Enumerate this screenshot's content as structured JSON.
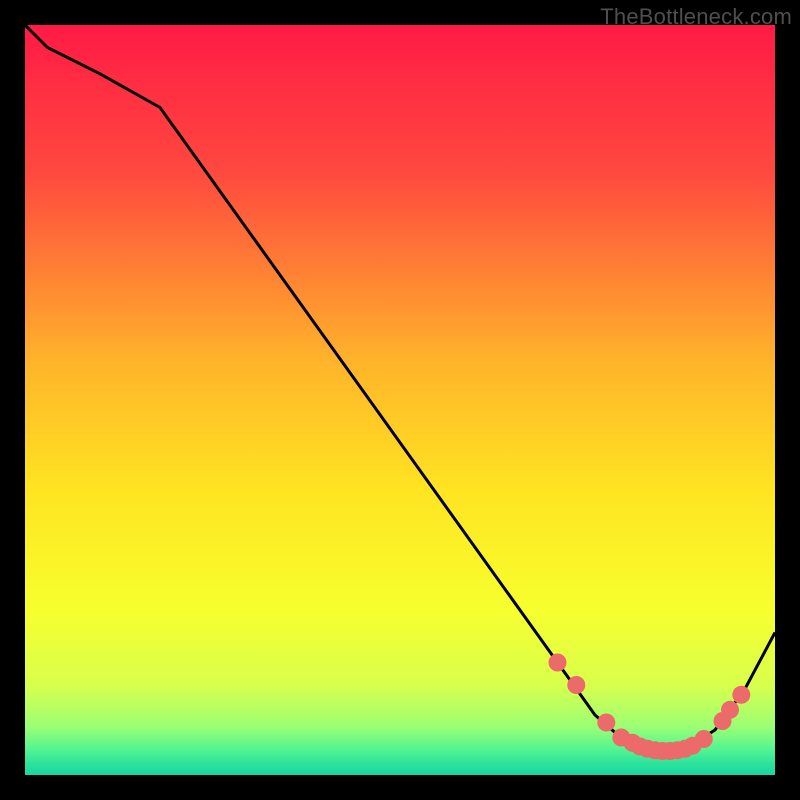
{
  "watermark": "TheBottleneck.com",
  "chart_data": {
    "type": "line",
    "title": "",
    "xlabel": "",
    "ylabel": "",
    "xlim": [
      0,
      100
    ],
    "ylim": [
      0,
      100
    ],
    "series": [
      {
        "name": "curve",
        "x": [
          0,
          3,
          10,
          18,
          71,
          76,
          80,
          84,
          88,
          92,
          96,
          100
        ],
        "y": [
          100,
          97,
          93.5,
          89,
          15,
          8,
          4.5,
          3.2,
          3.5,
          6,
          11.5,
          19
        ]
      }
    ],
    "markers": {
      "name": "dots",
      "x": [
        71,
        73.5,
        77.5,
        79.5,
        81,
        82,
        83,
        84,
        85,
        86,
        87,
        88,
        89,
        90.5,
        93,
        94,
        95.5
      ],
      "y": [
        15,
        12,
        7,
        5,
        4.3,
        3.8,
        3.5,
        3.3,
        3.2,
        3.2,
        3.3,
        3.5,
        3.9,
        4.8,
        7.2,
        8.7,
        10.7
      ]
    },
    "gradient_stops": [
      {
        "offset": 0.0,
        "color": "#ff1a45"
      },
      {
        "offset": 0.2,
        "color": "#ff4a3f"
      },
      {
        "offset": 0.45,
        "color": "#ffb42a"
      },
      {
        "offset": 0.62,
        "color": "#ffe421"
      },
      {
        "offset": 0.78,
        "color": "#f7ff2e"
      },
      {
        "offset": 0.88,
        "color": "#d8ff4c"
      },
      {
        "offset": 0.935,
        "color": "#9cff73"
      },
      {
        "offset": 0.965,
        "color": "#55f590"
      },
      {
        "offset": 0.985,
        "color": "#2be39b"
      },
      {
        "offset": 1.0,
        "color": "#18d6a0"
      }
    ],
    "curve_color": "#000000",
    "marker_color": "#ec6a69",
    "marker_radius": 9
  }
}
